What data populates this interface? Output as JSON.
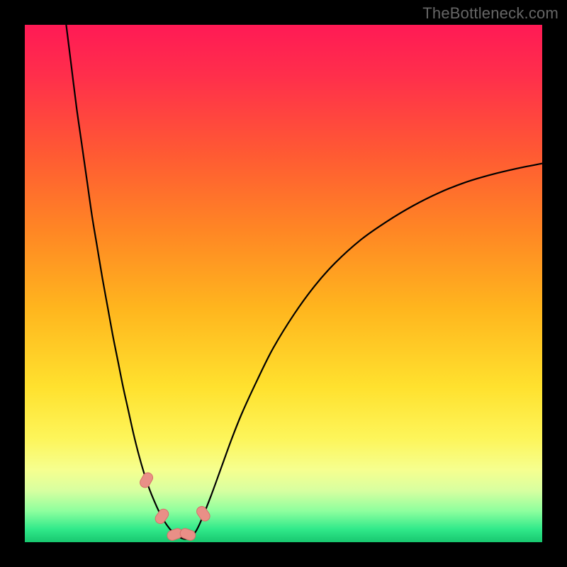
{
  "watermark": "TheBottleneck.com",
  "colors": {
    "frame": "#000000",
    "curve": "#000000",
    "marker_fill": "#e98f87",
    "marker_stroke": "#d57069",
    "gradient_stops": [
      {
        "offset": 0.0,
        "color": "#ff1a55"
      },
      {
        "offset": 0.1,
        "color": "#ff2f4b"
      },
      {
        "offset": 0.25,
        "color": "#ff5a33"
      },
      {
        "offset": 0.4,
        "color": "#ff8724"
      },
      {
        "offset": 0.55,
        "color": "#ffb61e"
      },
      {
        "offset": 0.7,
        "color": "#ffe12e"
      },
      {
        "offset": 0.8,
        "color": "#fdf55a"
      },
      {
        "offset": 0.86,
        "color": "#f6ff8f"
      },
      {
        "offset": 0.9,
        "color": "#d8ffa0"
      },
      {
        "offset": 0.94,
        "color": "#8dff9e"
      },
      {
        "offset": 0.975,
        "color": "#30e98a"
      },
      {
        "offset": 1.0,
        "color": "#18c76f"
      }
    ]
  },
  "chart_data": {
    "type": "line",
    "title": "",
    "xlabel": "",
    "ylabel": "",
    "xlim": [
      0,
      100
    ],
    "ylim": [
      0,
      100
    ],
    "x": [
      8,
      9,
      10,
      11,
      12,
      13,
      14,
      15,
      16,
      17,
      18,
      19,
      20,
      21,
      22,
      23,
      24,
      25,
      26,
      27,
      28,
      29,
      30,
      31,
      32,
      33,
      34,
      36,
      38,
      40,
      42,
      45,
      48,
      52,
      56,
      60,
      65,
      70,
      75,
      80,
      85,
      90,
      95,
      100
    ],
    "values": [
      100,
      92,
      84,
      77,
      70,
      63,
      57,
      51,
      45.5,
      40,
      35,
      30,
      25.5,
      21,
      17,
      13.5,
      10.5,
      8,
      5.8,
      4,
      2.6,
      1.6,
      0.9,
      0.6,
      0.9,
      2,
      4,
      9,
      14.5,
      20,
      25,
      31.5,
      37.5,
      44,
      49.5,
      54,
      58.5,
      62,
      65,
      67.5,
      69.5,
      71,
      72.2,
      73.2
    ],
    "markers_x": [
      23.5,
      26.5,
      29,
      31.5,
      34.5
    ],
    "markers_y": [
      12,
      5,
      1.5,
      1.5,
      5.5
    ]
  }
}
